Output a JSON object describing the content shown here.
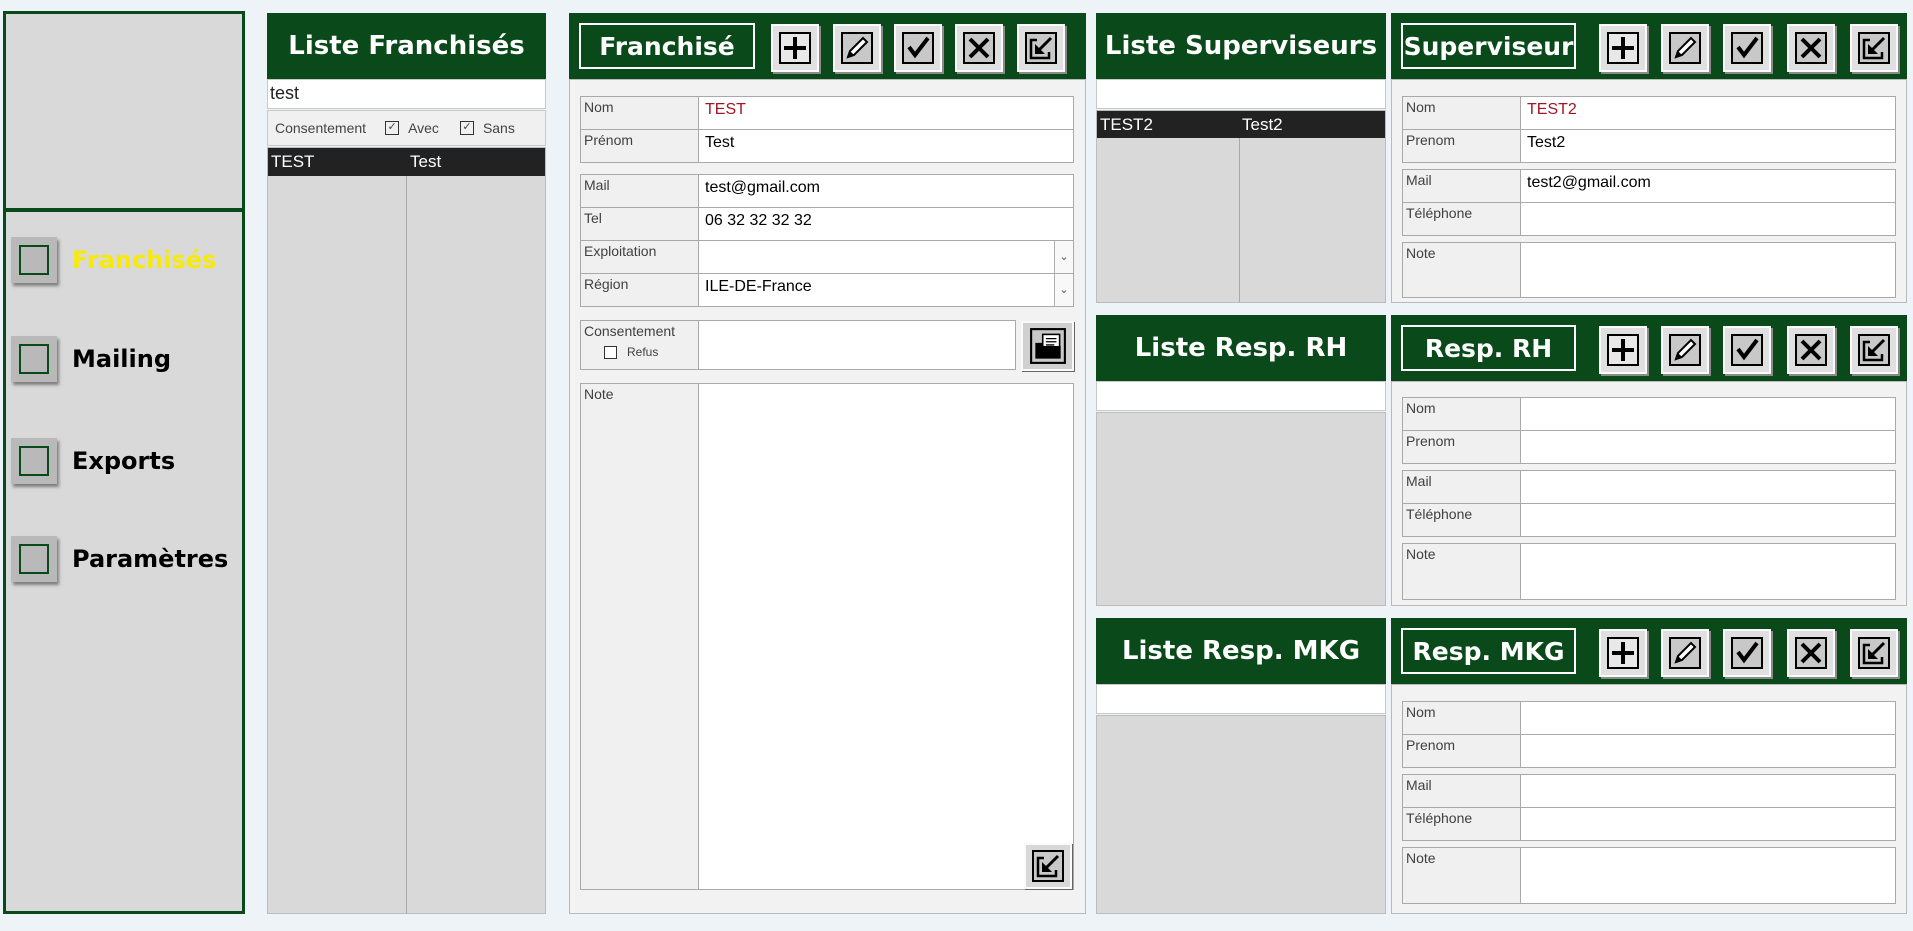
{
  "colors": {
    "header_green": "#0a4a1a",
    "active_nav": "#f7ea0a",
    "name_red": "#a0151f",
    "selected_row": "#222222"
  },
  "nav": {
    "items": [
      {
        "label": "Franchisés",
        "active": true
      },
      {
        "label": "Mailing",
        "active": false
      },
      {
        "label": "Exports",
        "active": false
      },
      {
        "label": "Paramètres",
        "active": false
      }
    ]
  },
  "franchise_list": {
    "title": "Liste Franchisés",
    "search_value": "test",
    "filter": {
      "label": "Consentement",
      "avec_label": "Avec",
      "avec_checked": true,
      "sans_label": "Sans",
      "sans_checked": true
    },
    "rows": [
      [
        "TEST",
        "Test"
      ]
    ]
  },
  "franchise_form": {
    "title": "Franchisé",
    "toolbar_icons": [
      "plus-icon",
      "pencil-icon",
      "check-icon",
      "close-icon",
      "export-icon"
    ],
    "nom_label": "Nom",
    "nom_value": "TEST",
    "prenom_label": "Prénom",
    "prenom_value": "Test",
    "mail_label": "Mail",
    "mail_value": "test@gmail.com",
    "tel_label": "Tel",
    "tel_value": "06 32 32 32 32",
    "exploitation_label": "Exploitation",
    "exploitation_value": "",
    "region_label": "Région",
    "region_value": "ILE-DE-France",
    "consent_label": "Consentement",
    "refus_label": "Refus",
    "refus_checked": false,
    "note_label": "Note"
  },
  "superviseur_list": {
    "title": "Liste Superviseurs",
    "rows": [
      [
        "TEST2",
        "Test2"
      ]
    ]
  },
  "superviseur_form": {
    "title": "Superviseur",
    "nom_label": "Nom",
    "nom_value": "TEST2",
    "prenom_label": "Prenom",
    "prenom_value": "Test2",
    "mail_label": "Mail",
    "mail_value": "test2@gmail.com",
    "tel_label": "Téléphone",
    "tel_value": "",
    "note_label": "Note"
  },
  "rh_list": {
    "title": "Liste Resp. RH"
  },
  "rh_form": {
    "title": "Resp. RH",
    "nom_label": "Nom",
    "prenom_label": "Prenom",
    "mail_label": "Mail",
    "tel_label": "Téléphone",
    "note_label": "Note"
  },
  "mkg_list": {
    "title": "Liste Resp. MKG"
  },
  "mkg_form": {
    "title": "Resp. MKG",
    "nom_label": "Nom",
    "prenom_label": "Prenom",
    "mail_label": "Mail",
    "tel_label": "Téléphone",
    "note_label": "Note"
  }
}
